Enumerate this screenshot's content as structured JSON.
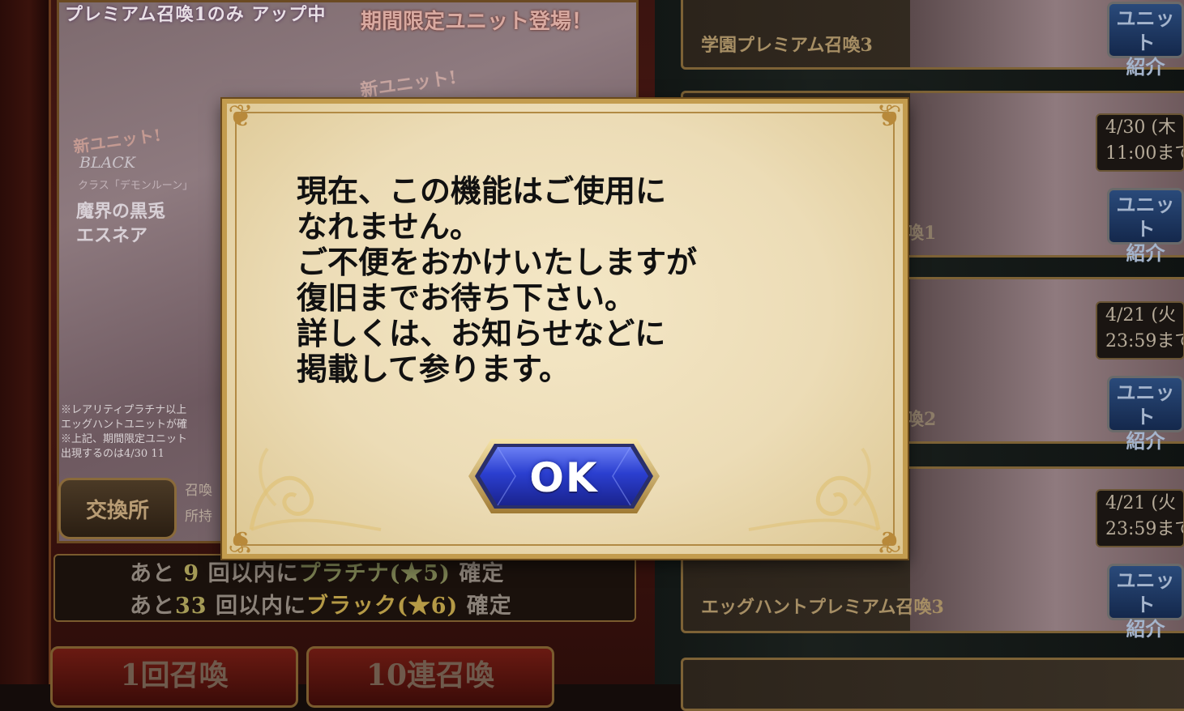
{
  "banner": {
    "top_left": "プレミアム召喚1のみ アップ中",
    "top_right": "期間限定ユニット登場！",
    "new_unit_1": "新ユニット!",
    "new_unit_2": "新ユニット!",
    "black_label": "BLACK",
    "class_label": "クラス「デモンルーン」",
    "unit_name_1": "魔界の黒兎",
    "unit_name_2": "エスネア",
    "note_lines": [
      "※レアリティプラチナ以上",
      "エッグハントユニットが確",
      "※上記、期間限定ユニット",
      "出現するのは4/30 11"
    ]
  },
  "exchange": {
    "label": "交換所",
    "side_line_1": "召喚",
    "side_line_2": "所持"
  },
  "guarantee": {
    "line1": {
      "prefix": "あと",
      "count": "9",
      "mid": "回以内に",
      "rarity": "プラチナ(★5)",
      "suffix": "確定"
    },
    "line2": {
      "prefix": "あと",
      "count": "33",
      "mid": "回以内に",
      "rarity": "ブラック(★6)",
      "suffix": "確定"
    }
  },
  "summon_buttons": {
    "single": "1回召喚",
    "ten": "10連召喚"
  },
  "list": {
    "item1_title": "学園プレミアム召喚3",
    "item4_title": "エッグハントプレミアム召喚3",
    "item2_partial": "喚1",
    "item3_partial": "喚2",
    "date1_line1": "4/30 (木",
    "date1_line2": "11:00まで",
    "date2_line1": "4/21 (火",
    "date2_line2": "23:59まで",
    "date3_line1": "4/21 (火",
    "date3_line2": "23:59まで",
    "unit_btn_line1": "ユニット",
    "unit_btn_line2": "紹介"
  },
  "dialog": {
    "message_lines": [
      "現在、この機能はご使用に",
      "なれません。",
      "ご不便をおかけいたしますが",
      "復旧までお待ち下さい。",
      "詳しくは、お知らせなどに",
      "掲載して参ります。"
    ],
    "ok_label": "OK"
  },
  "colors": {
    "dialog_bg": "#f1e3c0",
    "dialog_border": "#c39c4e",
    "ok_button": "#2b3fd0"
  }
}
